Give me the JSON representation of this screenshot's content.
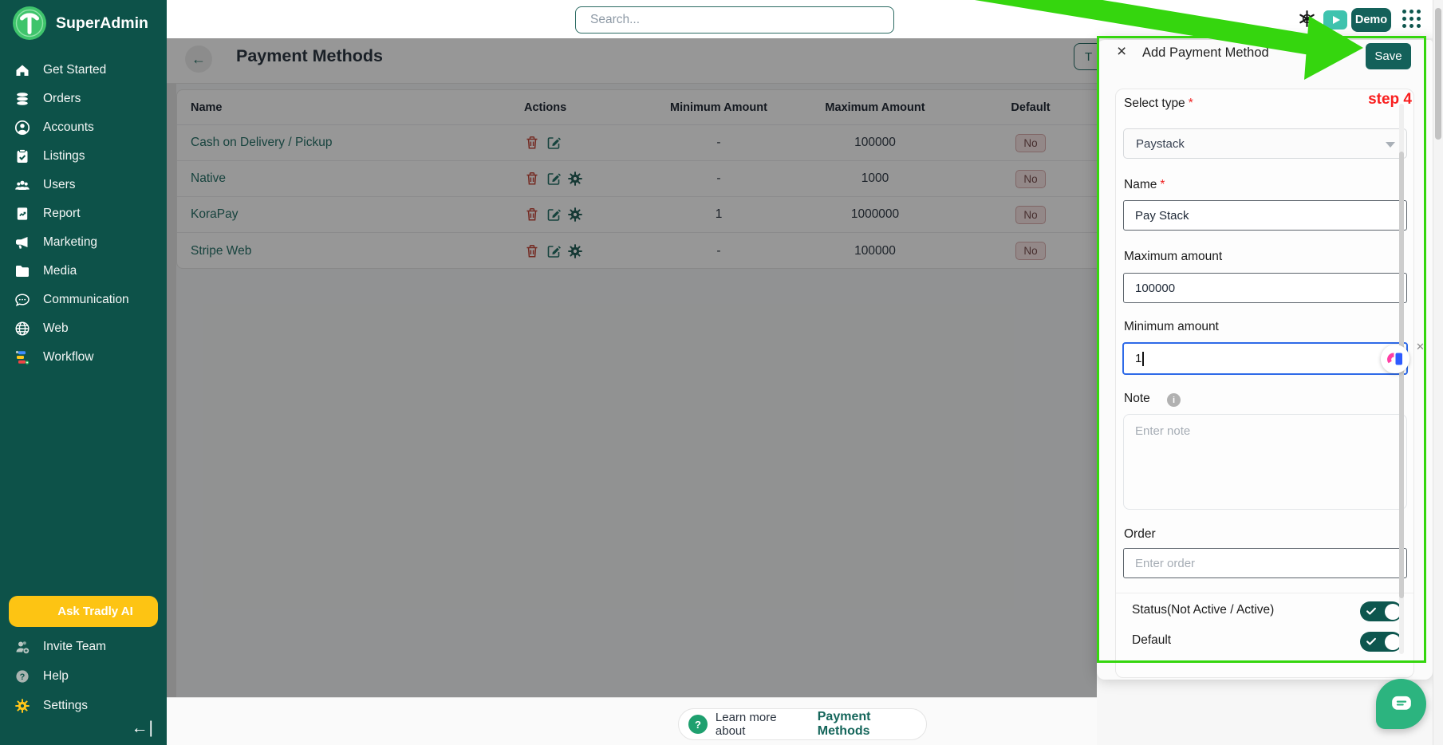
{
  "brand": {
    "name": "SuperAdmin"
  },
  "sidebar": {
    "items": [
      {
        "icon": "home-icon",
        "label": "Get Started"
      },
      {
        "icon": "orders-icon",
        "label": "Orders"
      },
      {
        "icon": "accounts-icon",
        "label": "Accounts"
      },
      {
        "icon": "listings-icon",
        "label": "Listings"
      },
      {
        "icon": "users-icon",
        "label": "Users"
      },
      {
        "icon": "report-icon",
        "label": "Report"
      },
      {
        "icon": "marketing-icon",
        "label": "Marketing"
      },
      {
        "icon": "media-icon",
        "label": "Media"
      },
      {
        "icon": "communication-icon",
        "label": "Communication"
      },
      {
        "icon": "web-icon",
        "label": "Web"
      },
      {
        "icon": "workflow-icon",
        "label": "Workflow"
      }
    ],
    "ai_button_label": "Ask Tradly AI",
    "footer_items": [
      {
        "icon": "invite-team-icon",
        "label": "Invite Team"
      },
      {
        "icon": "help-icon",
        "label": "Help"
      },
      {
        "icon": "settings-icon",
        "label": "Settings"
      }
    ],
    "collapse_glyph": "←|"
  },
  "topbar": {
    "search_placeholder": "Search...",
    "demo_label": "Demo"
  },
  "page": {
    "title": "Payment Methods",
    "partial_button_label": "T",
    "table": {
      "columns": [
        "Name",
        "Actions",
        "Minimum Amount",
        "Maximum Amount",
        "Default"
      ],
      "rows": [
        {
          "name": "Cash on Delivery / Pickup",
          "actions": [
            "trash-icon",
            "edit-icon"
          ],
          "minimum": "-",
          "maximum": "100000",
          "default": "No"
        },
        {
          "name": "Native",
          "actions": [
            "trash-icon",
            "edit-icon",
            "gear-icon"
          ],
          "minimum": "-",
          "maximum": "1000",
          "default": "No"
        },
        {
          "name": "KoraPay",
          "actions": [
            "trash-icon",
            "edit-icon",
            "gear-icon"
          ],
          "minimum": "1",
          "maximum": "1000000",
          "default": "No"
        },
        {
          "name": "Stripe Web",
          "actions": [
            "trash-icon",
            "edit-icon",
            "gear-icon"
          ],
          "minimum": "-",
          "maximum": "100000",
          "default": "No"
        }
      ]
    },
    "learn_more": {
      "prefix": "Learn more about",
      "topic": "Payment Methods"
    }
  },
  "panel": {
    "title": "Add Payment Method",
    "save_label": "Save",
    "required_mark": "*",
    "select_type": {
      "label": "Select type",
      "value": "Paystack"
    },
    "name_field": {
      "label": "Name",
      "value": "Pay Stack"
    },
    "max_field": {
      "label": "Maximum amount",
      "value": "100000"
    },
    "min_field": {
      "label": "Minimum amount",
      "value": "1"
    },
    "note_field": {
      "label": "Note",
      "placeholder": "Enter note"
    },
    "order_field": {
      "label": "Order",
      "placeholder": "Enter order"
    },
    "status_toggle": {
      "label": "Status(Not Active / Active)",
      "on": true
    },
    "default_toggle": {
      "label": "Default",
      "on": true
    }
  },
  "annotation": {
    "step_label": "step 4"
  },
  "chat": {
    "tooltip": "chat"
  },
  "colors": {
    "sidebar_bg": "#0d5249",
    "accent": "#14615a",
    "annotation_green": "#35d60e",
    "ai_yellow": "#fdc413",
    "step_red": "#f91f1f",
    "focus_blue": "#2e6ae8"
  }
}
